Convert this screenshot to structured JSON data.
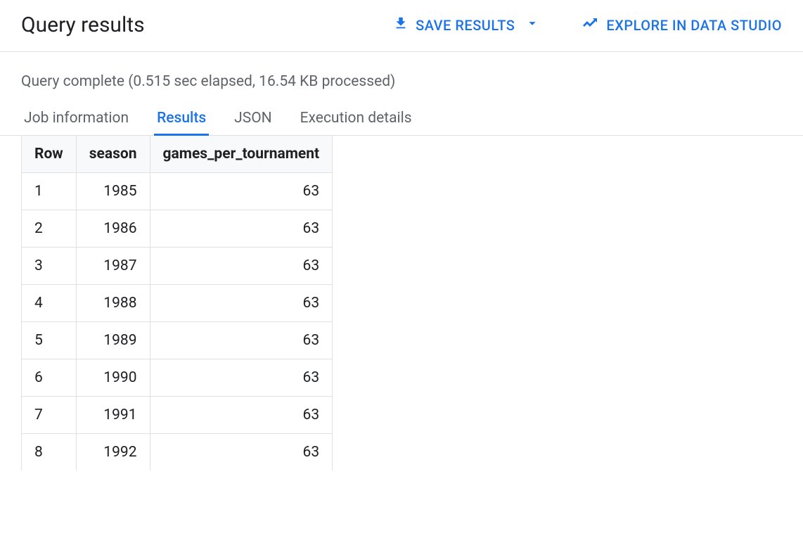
{
  "header": {
    "title": "Query results",
    "save_button_label": "SAVE RESULTS",
    "explore_button_label": "EXPLORE IN DATA STUDIO"
  },
  "status": {
    "text": "Query complete (0.515 sec elapsed, 16.54 KB processed)"
  },
  "tabs": {
    "items": [
      {
        "label": "Job information",
        "active": false
      },
      {
        "label": "Results",
        "active": true
      },
      {
        "label": "JSON",
        "active": false
      },
      {
        "label": "Execution details",
        "active": false
      }
    ]
  },
  "table": {
    "columns": [
      "Row",
      "season",
      "games_per_tournament"
    ],
    "rows": [
      {
        "row": "1",
        "season": "1985",
        "games_per_tournament": "63"
      },
      {
        "row": "2",
        "season": "1986",
        "games_per_tournament": "63"
      },
      {
        "row": "3",
        "season": "1987",
        "games_per_tournament": "63"
      },
      {
        "row": "4",
        "season": "1988",
        "games_per_tournament": "63"
      },
      {
        "row": "5",
        "season": "1989",
        "games_per_tournament": "63"
      },
      {
        "row": "6",
        "season": "1990",
        "games_per_tournament": "63"
      },
      {
        "row": "7",
        "season": "1991",
        "games_per_tournament": "63"
      },
      {
        "row": "8",
        "season": "1992",
        "games_per_tournament": "63"
      }
    ]
  }
}
